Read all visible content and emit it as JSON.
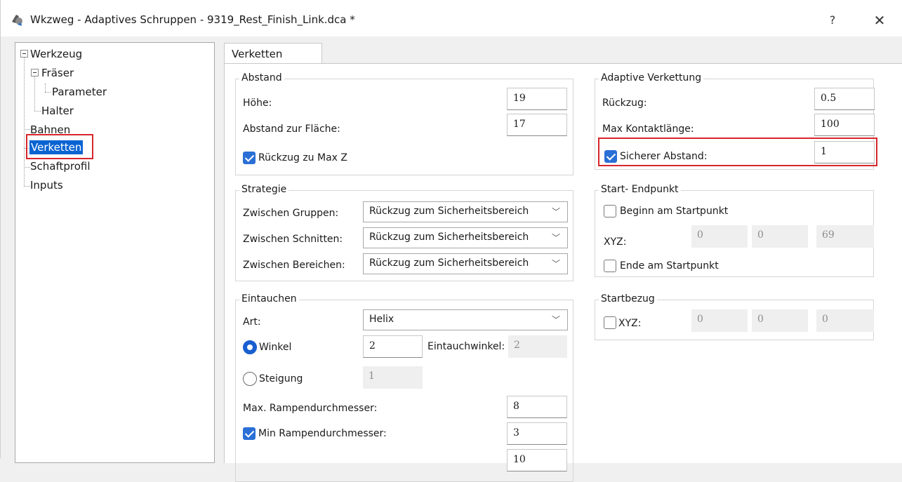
{
  "window": {
    "title": "Wkzweg - Adaptives Schruppen - 9319_Rest_Finish_Link.dca *",
    "help": "?",
    "close": "✕"
  },
  "tree": {
    "items": [
      {
        "label": "Werkzeug"
      },
      {
        "label": "Fräser"
      },
      {
        "label": "Parameter"
      },
      {
        "label": "Halter"
      },
      {
        "label": "Bahnen"
      },
      {
        "label": "Verketten"
      },
      {
        "label": "Schaftprofil"
      },
      {
        "label": "Inputs"
      }
    ],
    "selected": "Verketten"
  },
  "tab": {
    "label": "Verketten"
  },
  "abstand": {
    "title": "Abstand",
    "hoehe_label": "Höhe:",
    "hoehe_value": "19",
    "flaeche_label": "Abstand zur Fläche:",
    "flaeche_value": "17",
    "maxz_label": "Rückzug zu Max Z",
    "maxz_checked": true
  },
  "strategie": {
    "title": "Strategie",
    "gruppen_label": "Zwischen Gruppen:",
    "gruppen_value": "Rückzug zum Sicherheitsbereich",
    "schnitten_label": "Zwischen Schnitten:",
    "schnitten_value": "Rückzug zum Sicherheitsbereich",
    "bereichen_label": "Zwischen Bereichen:",
    "bereichen_value": "Rückzug zum Sicherheitsbereich"
  },
  "eintauchen": {
    "title": "Eintauchen",
    "art_label": "Art:",
    "art_value": "Helix",
    "winkel_label": "Winkel",
    "winkel_value": "2",
    "eintauchwinkel_label": "Eintauchwinkel:",
    "eintauchwinkel_value": "2",
    "steigung_label": "Steigung",
    "steigung_value": "1",
    "max_ramp_label": "Max. Rampendurchmesser:",
    "max_ramp_value": "8",
    "min_ramp_label": "Min Rampendurchmesser:",
    "min_ramp_value": "3",
    "cut_value": "10"
  },
  "adaptive": {
    "title": "Adaptive Verkettung",
    "rueckzug_label": "Rückzug:",
    "rueckzug_value": "0.5",
    "kontakt_label": "Max Kontaktlänge:",
    "kontakt_value": "100",
    "sicher_label": "Sicherer Abstand:",
    "sicher_value": "1",
    "sicher_checked": true
  },
  "startend": {
    "title": "Start- Endpunkt",
    "beginn_label": "Beginn am Startpunkt",
    "xyz_label": "XYZ:",
    "x": "0",
    "y": "0",
    "z": "69",
    "ende_label": "Ende am Startpunkt"
  },
  "startbezug": {
    "title": "Startbezug",
    "xyz_label": "XYZ:",
    "x": "0",
    "y": "0",
    "z": "0"
  },
  "colors": {
    "accent": "#0a64d2",
    "highlight": "#d6262b"
  }
}
